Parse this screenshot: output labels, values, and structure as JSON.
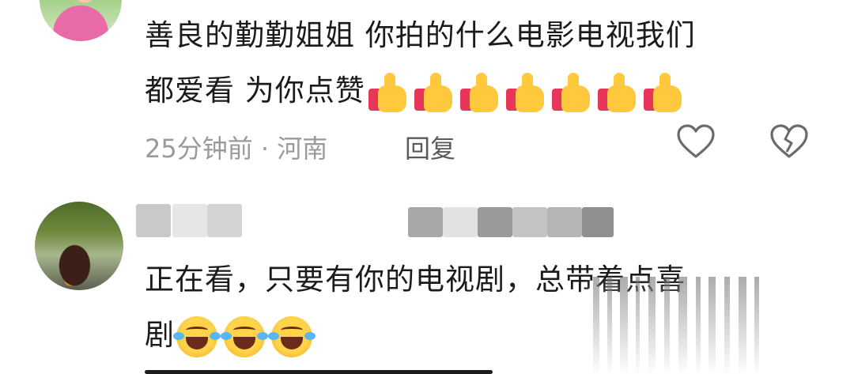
{
  "comment1": {
    "text_line1": "善良的勤勤姐姐  你拍的什么电影电视我们",
    "text_line2": "都爱看 为你点赞",
    "emoji": "thumbs-up",
    "emoji_count": 7,
    "time": "25分钟前",
    "separator": " · ",
    "location": "河南",
    "reply_label": "回复"
  },
  "comment2": {
    "text_line1": "正在看，只要有你的电视剧，总带着点喜",
    "text_line2": "剧",
    "emoji": "laughing-crying",
    "emoji_count": 3
  },
  "colors": {
    "text": "#1b1b1b",
    "meta": "#9a9a9a",
    "icon": "#6b6b6b"
  }
}
